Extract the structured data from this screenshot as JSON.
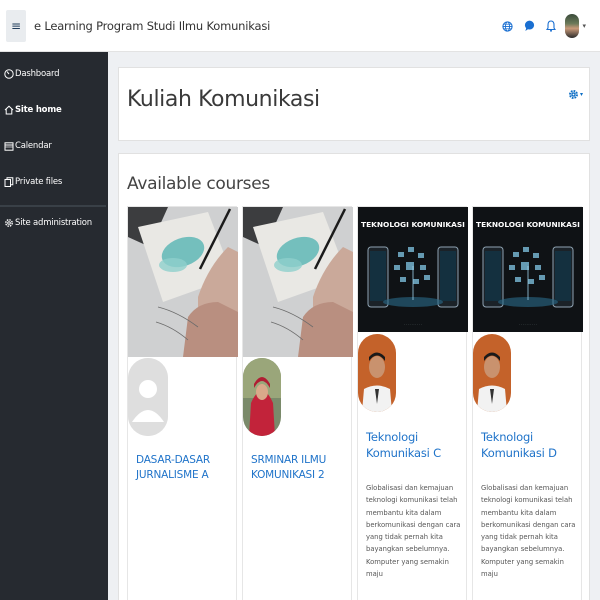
{
  "header": {
    "menu_glyph": "≡",
    "site_title": "e Learning Program Studi Ilmu Komunikasi",
    "icons": [
      "globe-icon",
      "chat-bubble-icon",
      "bell-icon"
    ],
    "user_menu_caret": "▾"
  },
  "sidebar": {
    "items": [
      {
        "label": "Dashboard",
        "icon": "gauge-icon",
        "active": false
      },
      {
        "label": "Site home",
        "icon": "home-icon",
        "active": true
      },
      {
        "label": "Calendar",
        "icon": "calendar-icon",
        "active": false
      },
      {
        "label": "Private files",
        "icon": "files-icon",
        "active": false
      },
      {
        "label": "Site administration",
        "icon": "gear-icon",
        "active": false
      }
    ]
  },
  "page": {
    "title": "Kuliah Komunikasi",
    "settings_caret": "▾"
  },
  "courses_section": {
    "title": "Available courses",
    "courses": [
      {
        "name": "DASAR-DASAR JURNALISME A",
        "summary": ""
      },
      {
        "name": "SRMINAR ILMU KOMUNIKASI 2",
        "summary": ""
      },
      {
        "name": "Teknologi Komunikasi C",
        "image_text": "TEKNOLOGI KOMUNIKASI",
        "summary": "Globalisasi dan kemajuan teknologi komunikasi telah membantu kita dalam berkomunikasi dengan cara yang tidak pernah kita bayangkan sebelumnya. Komputer yang semakin maju"
      },
      {
        "name": "Teknologi Komunikasi D",
        "image_text": "TEKNOLOGI KOMUNIKASI",
        "summary": "Globalisasi dan kemajuan teknologi komunikasi telah membantu kita dalam berkomunikasi dengan cara yang tidak pernah kita bayangkan sebelumnya. Komputer yang semakin maju"
      }
    ]
  },
  "colors": {
    "sidebar_bg": "#262a30",
    "link": "#1f73c9",
    "accent": "#0f6fc5"
  }
}
